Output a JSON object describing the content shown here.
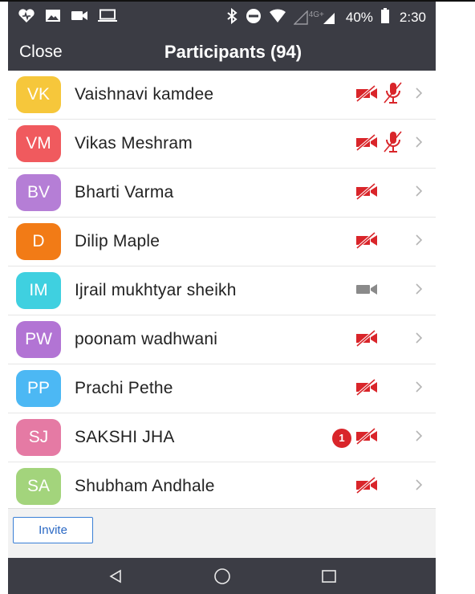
{
  "status_bar": {
    "network": "4G+",
    "battery": "40%",
    "time": "2:30",
    "icons": [
      "heart-icon",
      "image-icon",
      "video-icon",
      "laptop-icon",
      "bluetooth-icon",
      "do-not-disturb-icon",
      "wifi-icon",
      "signal-icon",
      "battery-icon"
    ]
  },
  "header": {
    "close_label": "Close",
    "title": "Participants (94)"
  },
  "participants": [
    {
      "initials": "VK",
      "name": "Vaishnavi kamdee",
      "color": "#f6c73b",
      "video": "off",
      "audio": "muted",
      "badge": ""
    },
    {
      "initials": "VM",
      "name": "Vikas Meshram",
      "color": "#f05a5e",
      "video": "off",
      "audio": "muted",
      "badge": ""
    },
    {
      "initials": "BV",
      "name": "Bharti Varma",
      "color": "#b57ed6",
      "video": "off",
      "audio": "none",
      "badge": ""
    },
    {
      "initials": "D",
      "name": "Dilip Maple",
      "color": "#f27b16",
      "video": "off",
      "audio": "none",
      "badge": ""
    },
    {
      "initials": "IM",
      "name": "Ijrail mukhtyar sheikh",
      "color": "#3fd0e0",
      "video": "on",
      "audio": "none",
      "badge": ""
    },
    {
      "initials": "PW",
      "name": "poonam wadhwani",
      "color": "#b274d4",
      "video": "off",
      "audio": "none",
      "badge": ""
    },
    {
      "initials": "PP",
      "name": "Prachi Pethe",
      "color": "#4cb8f4",
      "video": "off",
      "audio": "none",
      "badge": ""
    },
    {
      "initials": "SJ",
      "name": "SAKSHI JHA",
      "color": "#e57aa4",
      "video": "off",
      "audio": "none",
      "badge": "1"
    },
    {
      "initials": "SA",
      "name": "Shubham Andhale",
      "color": "#a3d47c",
      "video": "off",
      "audio": "none",
      "badge": ""
    }
  ],
  "footer": {
    "invite_label": "Invite"
  },
  "nav": {
    "icons": [
      "back-icon",
      "home-icon",
      "recents-icon"
    ]
  },
  "colors": {
    "header_bg": "#3b3c44",
    "muted_red": "#d9252a",
    "video_on_gray": "#8a8a8a",
    "invite_blue": "#3a7fd6"
  }
}
